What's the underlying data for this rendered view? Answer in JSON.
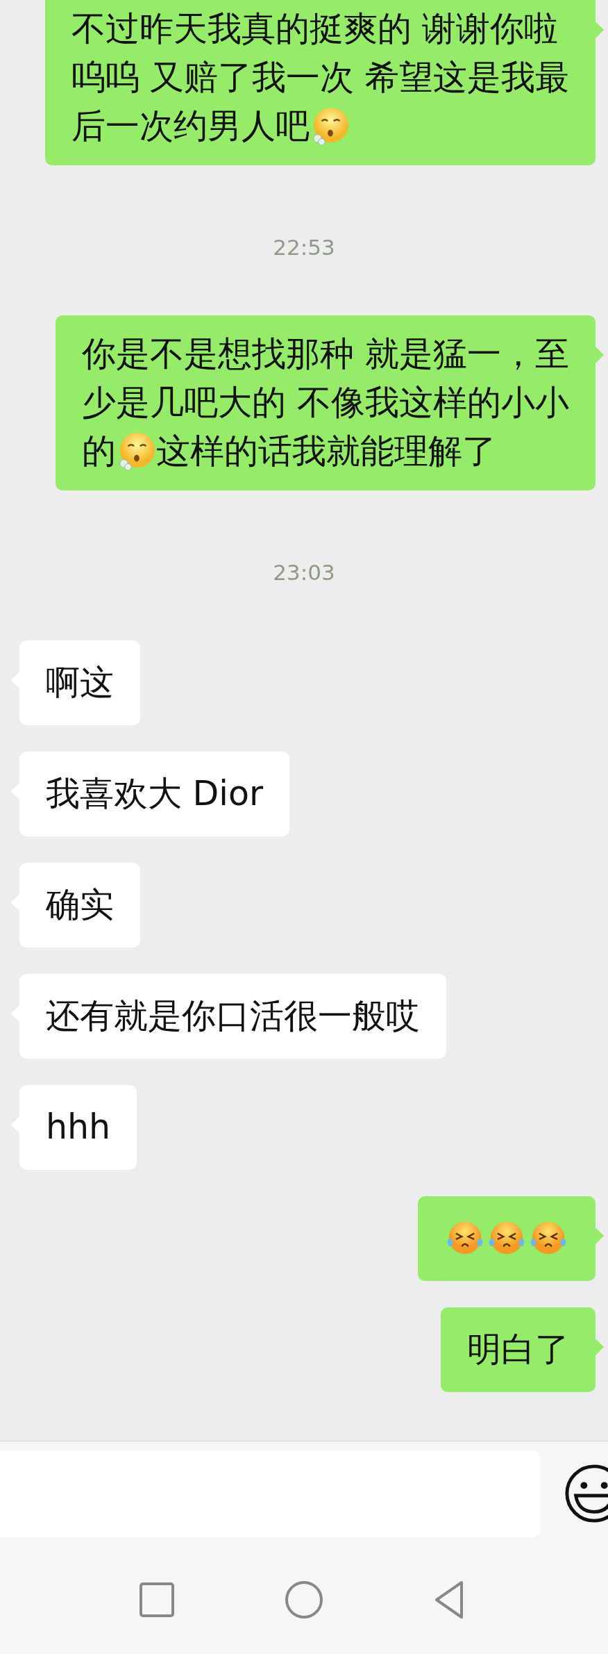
{
  "chat": [
    {
      "kind": "sent",
      "lines": [
        [
          {
            "kind": "text",
            "text": "不过昨天我真的挺爽的 谢谢你啦"
          }
        ],
        [
          {
            "kind": "text",
            "text": "呜呜 又赔了我一次 希望这是我最"
          }
        ],
        [
          {
            "kind": "text",
            "text": "后一次约男人吧"
          },
          {
            "kind": "sigh_emoji"
          }
        ]
      ]
    },
    {
      "kind": "time",
      "text": "22:53"
    },
    {
      "kind": "sent",
      "lines": [
        [
          {
            "kind": "text",
            "text": "你是不是想找那种 就是猛一，至"
          }
        ],
        [
          {
            "kind": "text",
            "text": "少是几吧大的 不像我这样的小小"
          }
        ],
        [
          {
            "kind": "text",
            "text": "的"
          },
          {
            "kind": "sigh_emoji"
          },
          {
            "kind": "text",
            "text": "这样的话我就能理解了"
          }
        ]
      ]
    },
    {
      "kind": "time",
      "text": "23:03"
    },
    {
      "kind": "received",
      "lines": [
        [
          {
            "kind": "text",
            "text": "啊这"
          }
        ]
      ]
    },
    {
      "kind": "received",
      "lines": [
        [
          {
            "kind": "text",
            "text": "我喜欢大 Dior"
          }
        ]
      ]
    },
    {
      "kind": "received",
      "lines": [
        [
          {
            "kind": "text",
            "text": "确实"
          }
        ]
      ]
    },
    {
      "kind": "received",
      "lines": [
        [
          {
            "kind": "text",
            "text": "还有就是你口活很一般哎"
          }
        ]
      ]
    },
    {
      "kind": "received",
      "lines": [
        [
          {
            "kind": "text",
            "text": "hhh"
          }
        ]
      ]
    },
    {
      "kind": "sent",
      "lines": [
        [
          {
            "kind": "laugh_cry_emoji"
          },
          {
            "kind": "laugh_cry_emoji"
          },
          {
            "kind": "laugh_cry_emoji"
          }
        ]
      ]
    },
    {
      "kind": "sent",
      "lines": [
        [
          {
            "kind": "text",
            "text": "明白了"
          }
        ]
      ]
    }
  ]
}
